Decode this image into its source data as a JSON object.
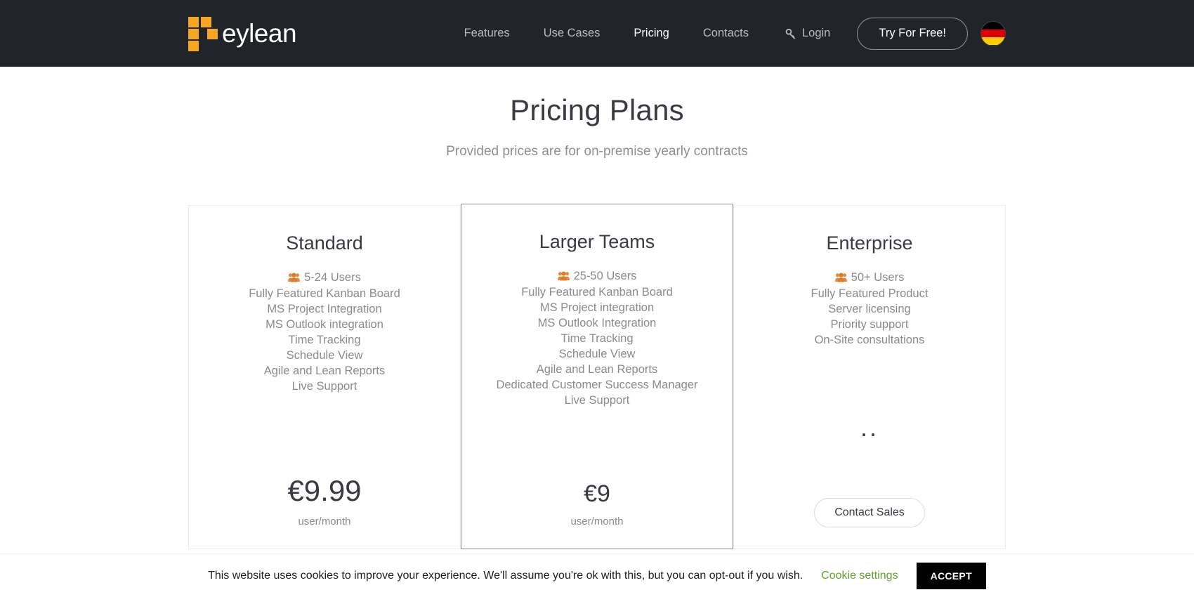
{
  "header": {
    "logo": {
      "text": "eylean",
      "icon": "logo-squares-icon",
      "accent_color": "#f5a623"
    },
    "nav": [
      {
        "label": "Features",
        "active": false
      },
      {
        "label": "Use Cases",
        "active": false
      },
      {
        "label": "Pricing",
        "active": true
      },
      {
        "label": "Contacts",
        "active": false
      }
    ],
    "login": {
      "label": "Login",
      "icon": "key-icon"
    },
    "cta": {
      "label": "Try For Free!"
    },
    "language": {
      "flag": "german-flag-icon",
      "colors": [
        "#000000",
        "#DD0000",
        "#FFCE00"
      ]
    },
    "background_color": "#212529"
  },
  "main": {
    "title": "Pricing Plans",
    "subtitle": "Provided prices are for on-premise yearly contracts",
    "plans": [
      {
        "name": "Standard",
        "featured": false,
        "users": "5-24 Users",
        "features": [
          "Fully Featured Kanban Board",
          "MS Project Integration",
          "MS Outlook integration",
          "Time Tracking",
          "Schedule View",
          "Agile and Lean Reports",
          "Live Support"
        ],
        "price": "€9.99",
        "price_unit": "user/month"
      },
      {
        "name": "Larger Teams",
        "featured": true,
        "users": "25-50 Users",
        "features": [
          "Fully Featured Kanban Board",
          "MS Project integration",
          "MS Outlook Integration",
          "Time Tracking",
          "Schedule View",
          "Agile and Lean Reports",
          "Dedicated Customer Success Manager",
          "Live Support"
        ],
        "price": "€9",
        "price_unit": "user/month"
      },
      {
        "name": "Enterprise",
        "featured": false,
        "users": "50+ Users",
        "features": [
          "Fully Featured Product",
          "Server licensing",
          "Priority support",
          "On-Site consultations"
        ],
        "price": "..",
        "price_unit": "",
        "button_label": "Contact Sales"
      }
    ]
  },
  "cookie_bar": {
    "message": "This website uses cookies to improve your experience. We'll assume you're ok with this, but you can opt-out if you wish.",
    "settings_label": "Cookie settings",
    "accept_label": "ACCEPT",
    "settings_color": "#61a229"
  }
}
